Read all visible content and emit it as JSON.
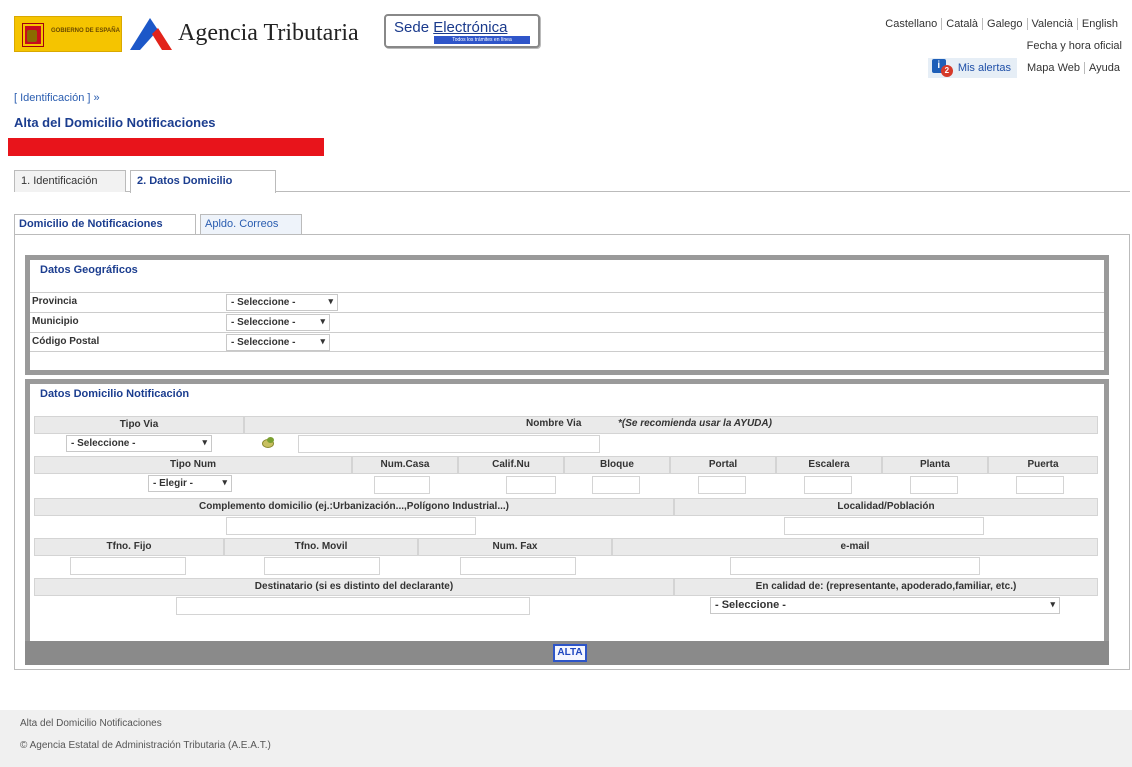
{
  "header": {
    "gov_logo_text": "GOBIERNO DE ESPAÑA",
    "agency_name": "Agencia Tributaria",
    "sede_title_prefix": "Sede ",
    "sede_title_word": "Electrónica",
    "sede_subtitle": "Todos los trámites en línea",
    "languages": [
      "Castellano",
      "Català",
      "Galego",
      "Valencià",
      "English"
    ],
    "fecha_hora": "Fecha y hora oficial",
    "alerts_count": "2",
    "alerts_label": "Mis alertas",
    "links": [
      "Mapa Web",
      "Ayuda"
    ]
  },
  "breadcrumb": "[ Identificación ] »",
  "page_title": "Alta del Domicilio Notificaciones",
  "steps": [
    "1. Identificación",
    "2. Datos Domicilio"
  ],
  "subtabs": [
    "Domicilio de Notificaciones",
    "Apldo. Correos"
  ],
  "geo": {
    "legend": "Datos Geográficos",
    "rows": [
      {
        "label": "Provincia",
        "value": "- Seleccione -"
      },
      {
        "label": "Municipio",
        "value": "- Seleccione -"
      },
      {
        "label": "Código Postal",
        "value": "- Seleccione -"
      }
    ]
  },
  "domicilio": {
    "legend": "Datos Domicilio Notificación",
    "tipo_via": "Tipo Via",
    "tipo_via_value": "- Seleccione -",
    "nombre_via": "Nombre Via",
    "nombre_via_note": "*(Se recomienda usar la AYUDA)",
    "tipo_num": "Tipo Num",
    "tipo_num_value": "- Elegir -",
    "num_cols": [
      "Num.Casa",
      "Calif.Nu",
      "Bloque",
      "Portal",
      "Escalera",
      "Planta",
      "Puerta"
    ],
    "complemento": "Complemento domicilio (ej.:Urbanización...,Polígono Industrial...)",
    "localidad": "Localidad/Población",
    "contact_cols": [
      "Tfno. Fijo",
      "Tfno. Movil",
      "Num. Fax",
      "e-mail"
    ],
    "destinatario": "Destinatario (si es distinto del declarante)",
    "calidad": "En calidad de: (representante, apoderado,familiar, etc.)",
    "calidad_value": "- Seleccione -"
  },
  "alta_button": "ALTA",
  "footer": {
    "line1": "Alta del Domicilio Notificaciones",
    "line2": "© Agencia Estatal de Administración Tributaria (A.E.A.T.)"
  },
  "colors": {
    "title_blue": "#1b3d8f",
    "red_bar": "#e8141b",
    "panel_gray": "#9a9a9a"
  }
}
